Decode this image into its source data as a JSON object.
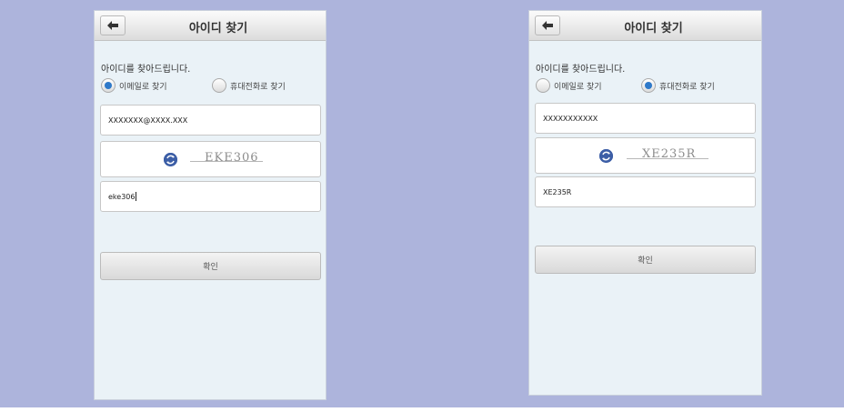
{
  "screens": [
    {
      "title": "아이디 찾기",
      "guide": "아이디를 찾아드립니다.",
      "radio_email_label": "이메일로 찾기",
      "radio_phone_label": "휴대전화로 찾기",
      "selected": "email",
      "contact_value": "XXXXXXX@XXXX.XXX",
      "captcha_text": "EKE306",
      "captcha_input": "eke306",
      "confirm_label": "확인"
    },
    {
      "title": "아이디 찾기",
      "guide": "아이디를 찾아드립니다.",
      "radio_email_label": "이메일로 찾기",
      "radio_phone_label": "휴대전화로 찾기",
      "selected": "phone",
      "contact_value": "XXXXXXXXXXX",
      "captcha_text": "XE235R",
      "captcha_input": "XE235R",
      "confirm_label": "확인"
    }
  ],
  "icons": {
    "back": "back-arrow-icon",
    "refresh": "refresh-icon"
  },
  "colors": {
    "page_background": "#adb4dc",
    "screen_background": "#eaf2f7",
    "radio_selected": "#2f79c9",
    "refresh_icon": "#3c5ea6"
  }
}
